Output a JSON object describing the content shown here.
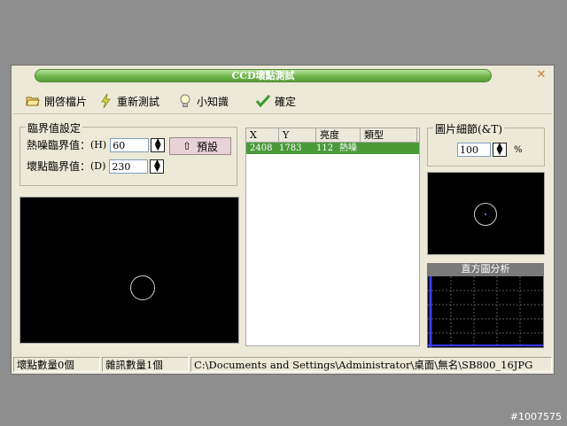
{
  "window": {
    "title": "CCD壞點測試",
    "close_label": "✕"
  },
  "toolbar": {
    "open_label": "開啓檔片",
    "retest_label": "重新測試",
    "tips_label": "小知識",
    "confirm_label": "確定"
  },
  "threshold": {
    "group_label": "臨界值設定",
    "hot_label": "熱噪臨界值：",
    "hot_hotkey": "(H)",
    "hot_value": "60",
    "dead_label": "壞點臨界值：",
    "dead_hotkey": "(D)",
    "dead_value": "230",
    "preset_label": "預設"
  },
  "table": {
    "columns": [
      "X",
      "Y",
      "亮度",
      "類型"
    ],
    "rows": [
      {
        "x": "2408",
        "y": "1783",
        "brightness": "112",
        "type": "熱噪"
      }
    ]
  },
  "detail": {
    "label": "圖片細節(&T)",
    "value": "100",
    "unit": "%"
  },
  "histogram": {
    "title": "直方圖分析"
  },
  "status": {
    "dead_count": "壞點數量0個",
    "noise_count": "雜訊數量1個",
    "path": "C:\\Documents and Settings\\Administrator\\桌面\\無名\\SB800_16JPG"
  },
  "watermark": "#1007575",
  "colors": {
    "titlebar": "#6fb44a",
    "selected_row": "#4a9a3a",
    "preset_button": "#e7d2d8"
  }
}
